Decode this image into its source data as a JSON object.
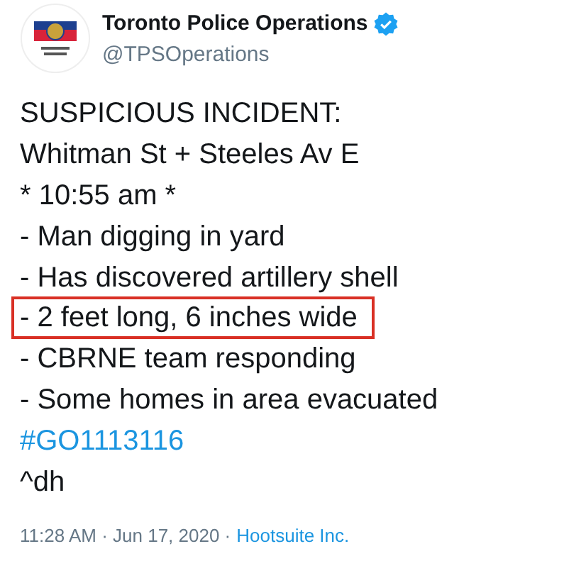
{
  "account": {
    "name": "Toronto Police Operations",
    "verified": true,
    "handle": "@TPSOperations"
  },
  "lines": [
    {
      "kind": "text",
      "text": "SUSPICIOUS INCIDENT:",
      "highlighted": false
    },
    {
      "kind": "text",
      "text": "Whitman St + Steeles Av E",
      "highlighted": false
    },
    {
      "kind": "text",
      "text": "* 10:55 am *",
      "highlighted": false
    },
    {
      "kind": "text",
      "text": "- Man digging in yard",
      "highlighted": false
    },
    {
      "kind": "text",
      "text": "- Has discovered artillery shell",
      "highlighted": false
    },
    {
      "kind": "text",
      "text": "- 2 feet long, 6 inches wide",
      "highlighted": true
    },
    {
      "kind": "text",
      "text": "- CBRNE team responding",
      "highlighted": false
    },
    {
      "kind": "text",
      "text": "- Some homes in area evacuated",
      "highlighted": false
    },
    {
      "kind": "hashtag",
      "text": "#GO1113116",
      "highlighted": false
    },
    {
      "kind": "text",
      "text": "^dh",
      "highlighted": false
    }
  ],
  "footer": {
    "time": "11:28 AM · Jun 17, 2020 ·",
    "source": "Hootsuite Inc."
  }
}
